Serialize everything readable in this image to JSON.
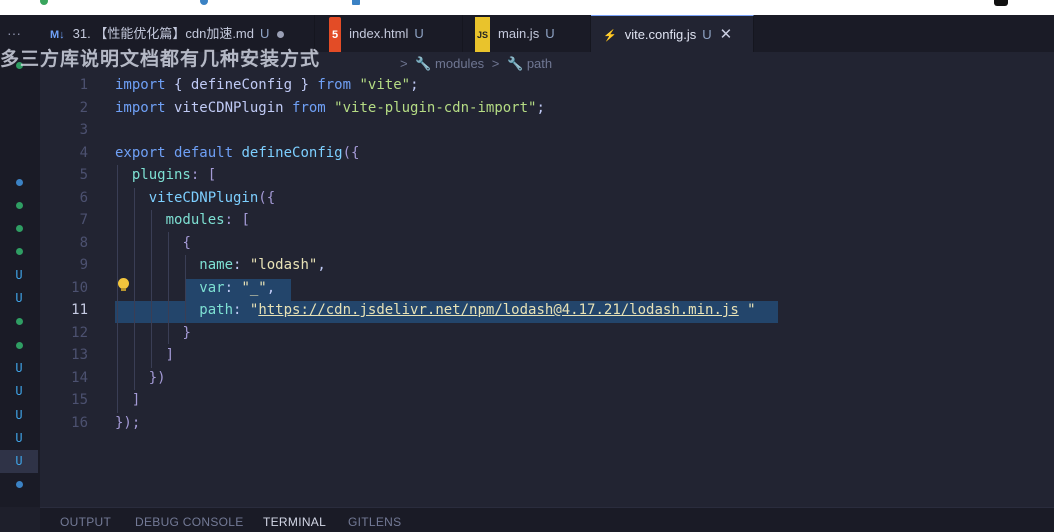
{
  "tabs": [
    {
      "icon": "M↓",
      "label": "31. 【性能优化篇】cdn加速.md",
      "status": "U",
      "modified": true
    },
    {
      "icon": "5",
      "label": "index.html",
      "status": "U"
    },
    {
      "icon": "JS",
      "label": "main.js",
      "status": "U"
    },
    {
      "icon": "⚡",
      "label": "vite.config.js",
      "status": "U",
      "active": true
    }
  ],
  "overlay_text": "多三方库说明文档都有几种安装方式",
  "breadcrumb": [
    ">",
    "modules",
    ">",
    "path"
  ],
  "editor": {
    "line_numbers": [
      "1",
      "2",
      "3",
      "4",
      "5",
      "6",
      "7",
      "8",
      "9",
      "10",
      "11",
      "12",
      "13",
      "14",
      "15",
      "16"
    ],
    "current_line": "11",
    "lines": [
      [
        {
          "t": "import",
          "c": "k"
        },
        {
          "t": " { ",
          "c": "p"
        },
        {
          "t": "defineConfig",
          "c": "p"
        },
        {
          "t": " } ",
          "c": "p"
        },
        {
          "t": "from",
          "c": "k"
        },
        {
          "t": " ",
          "c": "p"
        },
        {
          "t": "\"vite\"",
          "c": "s"
        },
        {
          "t": ";",
          "c": "p"
        }
      ],
      [
        {
          "t": "import",
          "c": "k"
        },
        {
          "t": " viteCDNPlugin ",
          "c": "p"
        },
        {
          "t": "from",
          "c": "k"
        },
        {
          "t": " ",
          "c": "p"
        },
        {
          "t": "\"vite-plugin-cdn-import\"",
          "c": "s"
        },
        {
          "t": ";",
          "c": "p"
        }
      ],
      [],
      [
        {
          "t": "export",
          "c": "k"
        },
        {
          "t": " ",
          "c": "p"
        },
        {
          "t": "default",
          "c": "k"
        },
        {
          "t": " ",
          "c": "p"
        },
        {
          "t": "defineConfig",
          "c": "f"
        },
        {
          "t": "({",
          "c": "br"
        }
      ],
      [
        {
          "t": "  ",
          "c": "p"
        },
        {
          "t": "plugins",
          "c": "pr"
        },
        {
          "t": ": [",
          "c": "br"
        }
      ],
      [
        {
          "t": "    ",
          "c": "p"
        },
        {
          "t": "viteCDNPlugin",
          "c": "f"
        },
        {
          "t": "({",
          "c": "br"
        }
      ],
      [
        {
          "t": "      ",
          "c": "p"
        },
        {
          "t": "modules",
          "c": "pr"
        },
        {
          "t": ": [",
          "c": "br"
        }
      ],
      [
        {
          "t": "        ",
          "c": "p"
        },
        {
          "t": "{",
          "c": "br"
        }
      ],
      [
        {
          "t": "          ",
          "c": "p"
        },
        {
          "t": "name",
          "c": "pr"
        },
        {
          "t": ": ",
          "c": "p"
        },
        {
          "t": "\"lodash\"",
          "c": "q"
        },
        {
          "t": ",",
          "c": "p"
        }
      ],
      [
        {
          "t": "          ",
          "c": "p"
        },
        {
          "t": "var",
          "c": "pr"
        },
        {
          "t": ": ",
          "c": "p"
        },
        {
          "t": "\"_\"",
          "c": "q"
        },
        {
          "t": ",",
          "c": "p"
        }
      ],
      [
        {
          "t": "          ",
          "c": "p"
        },
        {
          "t": "path",
          "c": "pr"
        },
        {
          "t": ": ",
          "c": "p"
        },
        {
          "t": "\"",
          "c": "q"
        },
        {
          "t": "https://cdn.jsdelivr.net/npm/lodash@4.17.21/lodash.min.js",
          "c": "q url"
        },
        {
          "t": " \"",
          "c": "q"
        }
      ],
      [
        {
          "t": "        ",
          "c": "p"
        },
        {
          "t": "}",
          "c": "br"
        }
      ],
      [
        {
          "t": "      ",
          "c": "p"
        },
        {
          "t": "]",
          "c": "br"
        }
      ],
      [
        {
          "t": "    ",
          "c": "p"
        },
        {
          "t": "})",
          "c": "br"
        }
      ],
      [
        {
          "t": "  ",
          "c": "p"
        },
        {
          "t": "]",
          "c": "br"
        }
      ],
      [
        {
          "t": "});",
          "c": "br"
        }
      ]
    ]
  },
  "activity_markers": [
    "dot",
    "",
    "",
    "",
    "",
    "dot",
    "dot",
    "dot",
    "dot",
    "U",
    "U",
    "dot",
    "dot",
    "U",
    "U",
    "U",
    "U",
    "U",
    "dot"
  ],
  "panel_tabs": [
    {
      "label": "OUTPUT"
    },
    {
      "label": "DEBUG CONSOLE"
    },
    {
      "label": "TERMINAL",
      "active": true
    },
    {
      "label": "GITLENS"
    }
  ],
  "colors": {
    "accent": "#7aa2f7",
    "selection": "#23456b",
    "git_untracked": "#3fa3e6",
    "git_dot": "#2f9e63"
  }
}
